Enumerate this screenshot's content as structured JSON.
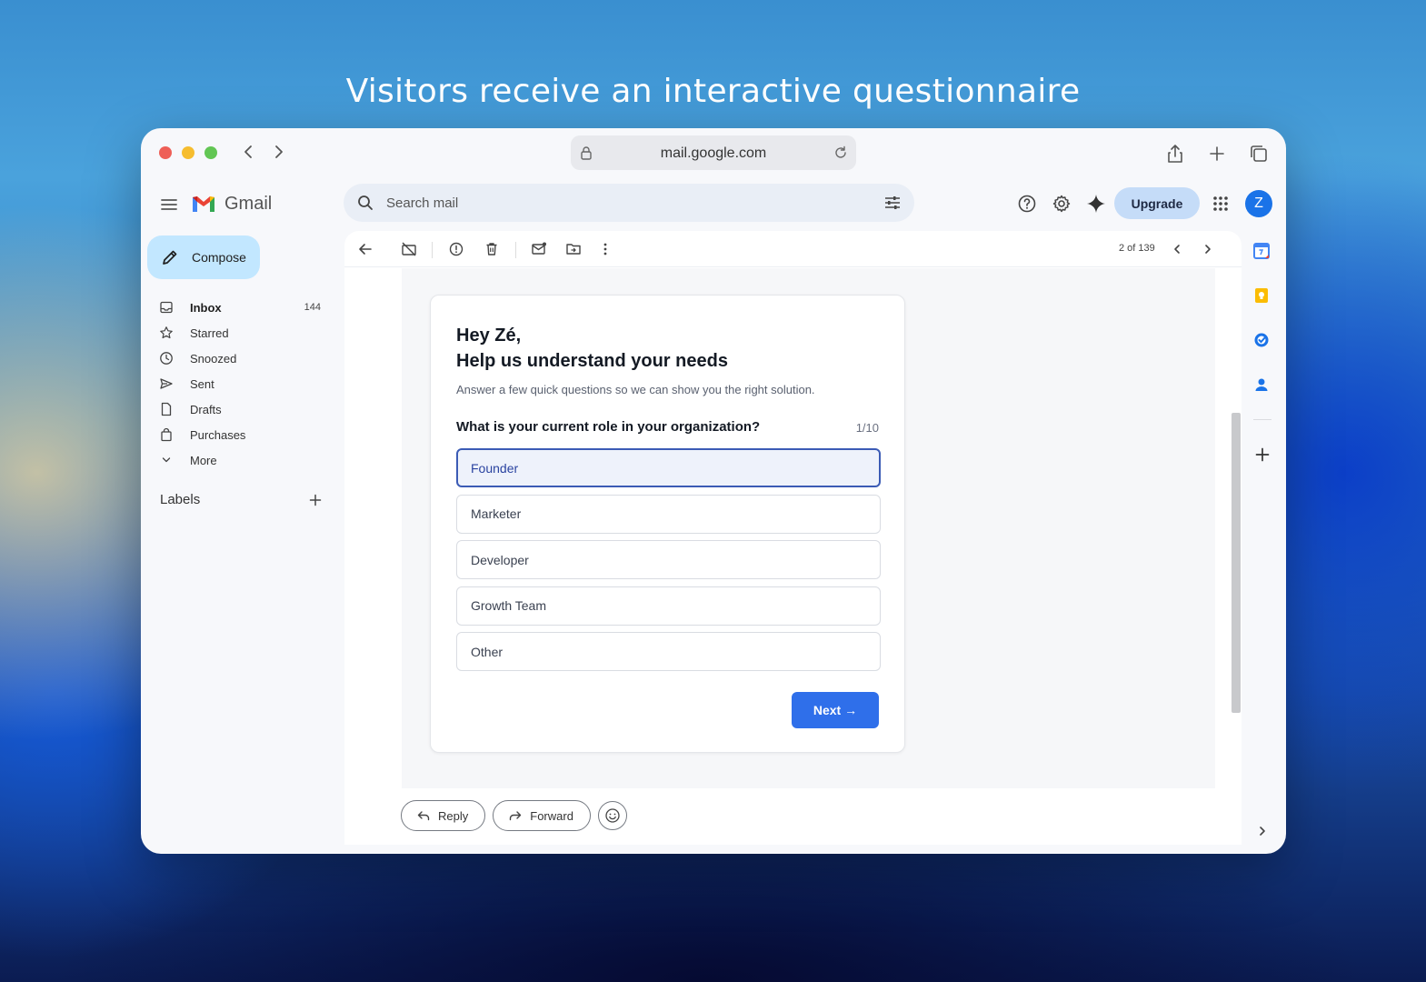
{
  "headline": "Visitors receive an interactive questionnaire",
  "browser": {
    "url": "mail.google.com"
  },
  "gmail": {
    "brand": "Gmail",
    "search_placeholder": "Search mail",
    "upgrade_label": "Upgrade",
    "avatar_initial": "Z",
    "compose_label": "Compose",
    "nav": [
      {
        "label": "Inbox",
        "count": "144",
        "icon": "inbox-icon"
      },
      {
        "label": "Starred",
        "count": "",
        "icon": "star-icon"
      },
      {
        "label": "Snoozed",
        "count": "",
        "icon": "clock-icon"
      },
      {
        "label": "Sent",
        "count": "",
        "icon": "send-icon"
      },
      {
        "label": "Drafts",
        "count": "",
        "icon": "draft-icon"
      },
      {
        "label": "Purchases",
        "count": "",
        "icon": "bag-icon"
      },
      {
        "label": "More",
        "count": "",
        "icon": "chevron-down-icon"
      }
    ],
    "labels_heading": "Labels",
    "paging": "2 of 139",
    "reply_label": "Reply",
    "forward_label": "Forward"
  },
  "questionnaire": {
    "greeting_line1": "Hey Zé,",
    "greeting_line2": "Help us understand your needs",
    "subtitle": "Answer a few quick questions so we can show you the right solution.",
    "question": "What is your current role in your organization?",
    "progress": "1/10",
    "options": [
      "Founder",
      "Marketer",
      "Developer",
      "Growth Team",
      "Other"
    ],
    "selected": "Founder",
    "next_label": "Next →"
  },
  "colors": {
    "accent": "#2f6fea",
    "selected_border": "#3b5bb5",
    "compose_bg": "#c2e7ff",
    "upgrade_bg": "#c5dcf8"
  }
}
